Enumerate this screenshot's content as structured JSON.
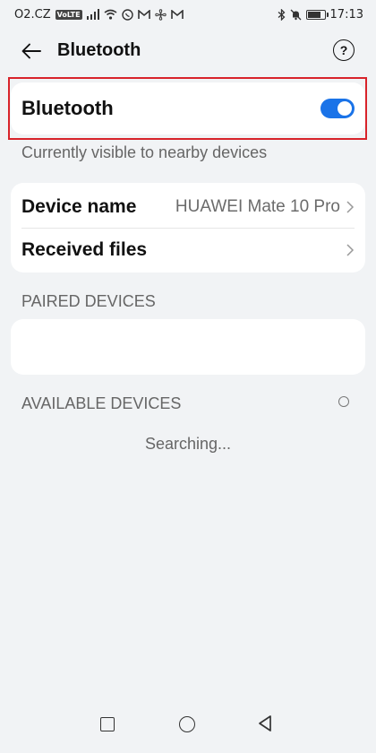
{
  "status_bar": {
    "carrier": "O2.CZ",
    "volte": "VoLTE",
    "time": "17:13"
  },
  "header": {
    "title": "Bluetooth",
    "help_icon": "help-icon",
    "help_glyph": "?"
  },
  "bluetooth": {
    "label": "Bluetooth",
    "enabled": true,
    "visibility_text": "Currently visible to nearby devices"
  },
  "device": {
    "name_label": "Device name",
    "name_value": "HUAWEI Mate 10 Pro",
    "received_label": "Received files"
  },
  "paired": {
    "title": "PAIRED DEVICES"
  },
  "available": {
    "title": "AVAILABLE DEVICES",
    "status": "Searching..."
  },
  "colors": {
    "accent": "#1a73e8",
    "highlight": "#d8232a",
    "background": "#f1f3f5"
  }
}
